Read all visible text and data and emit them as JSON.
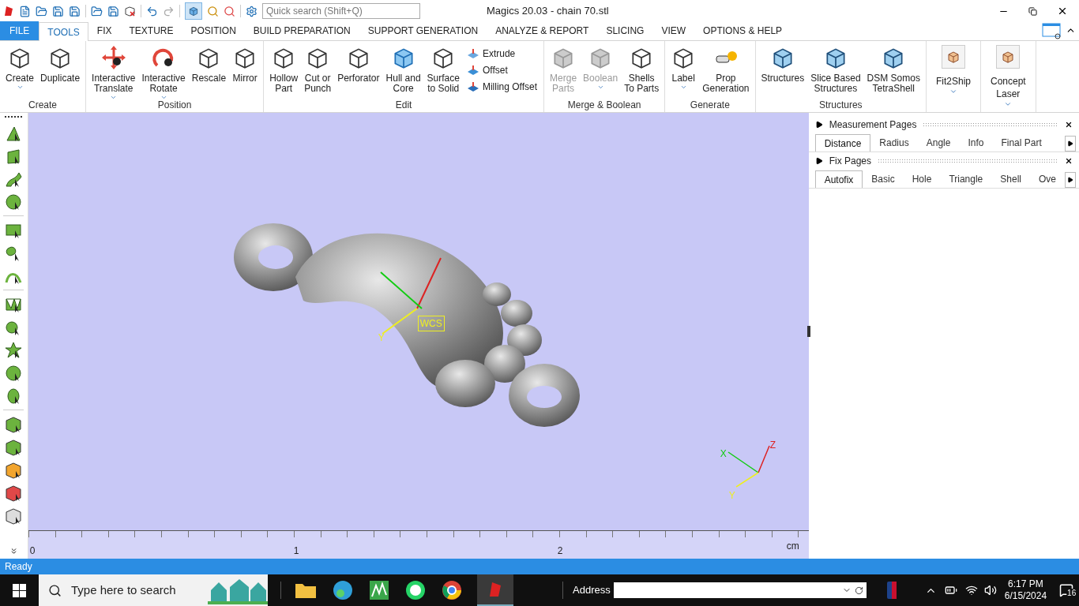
{
  "window": {
    "title": "Magics 20.03 - chain 70.stl"
  },
  "quick_search": {
    "placeholder": "Quick search (Shift+Q)"
  },
  "tabs": [
    {
      "label": "FILE",
      "kind": "file",
      "selected": false
    },
    {
      "label": "TOOLS",
      "kind": "tab",
      "selected": true
    },
    {
      "label": "FIX",
      "kind": "tab",
      "selected": false
    },
    {
      "label": "TEXTURE",
      "kind": "tab",
      "selected": false
    },
    {
      "label": "POSITION",
      "kind": "tab",
      "selected": false
    },
    {
      "label": "BUILD PREPARATION",
      "kind": "tab",
      "selected": false
    },
    {
      "label": "SUPPORT GENERATION",
      "kind": "tab",
      "selected": false
    },
    {
      "label": "ANALYZE & REPORT",
      "kind": "tab",
      "selected": false
    },
    {
      "label": "SLICING",
      "kind": "tab",
      "selected": false
    },
    {
      "label": "VIEW",
      "kind": "tab",
      "selected": false
    },
    {
      "label": "OPTIONS & HELP",
      "kind": "tab",
      "selected": false
    }
  ],
  "ribbon": [
    {
      "label": "Create",
      "buttons": [
        {
          "kind": "large",
          "label": "Create",
          "dropdown": true,
          "disabled": false
        },
        {
          "kind": "large",
          "label": "Duplicate",
          "dropdown": false,
          "disabled": false
        }
      ]
    },
    {
      "label": "Position",
      "buttons": [
        {
          "kind": "large",
          "label": "Interactive\nTranslate",
          "dropdown": true,
          "disabled": false
        },
        {
          "kind": "large",
          "label": "Interactive\nRotate",
          "dropdown": true,
          "disabled": false
        },
        {
          "kind": "large",
          "label": "Rescale",
          "dropdown": false,
          "disabled": false
        },
        {
          "kind": "large",
          "label": "Mirror",
          "dropdown": false,
          "disabled": false
        }
      ]
    },
    {
      "label": "Edit",
      "buttons": [
        {
          "kind": "large",
          "label": "Hollow\nPart",
          "dropdown": false,
          "disabled": false
        },
        {
          "kind": "large",
          "label": "Cut or\nPunch",
          "dropdown": false,
          "disabled": false
        },
        {
          "kind": "large",
          "label": "Perforator",
          "dropdown": false,
          "disabled": false
        },
        {
          "kind": "large",
          "label": "Hull and\nCore",
          "dropdown": false,
          "disabled": false
        },
        {
          "kind": "large",
          "label": "Surface\nto Solid",
          "dropdown": false,
          "disabled": false
        },
        {
          "kind": "small",
          "label": "Extrude",
          "disabled": false
        },
        {
          "kind": "small",
          "label": "Offset",
          "disabled": false
        },
        {
          "kind": "small",
          "label": "Milling Offset",
          "disabled": false
        }
      ]
    },
    {
      "label": "Merge & Boolean",
      "buttons": [
        {
          "kind": "large",
          "label": "Merge\nParts",
          "dropdown": false,
          "disabled": true
        },
        {
          "kind": "large",
          "label": "Boolean",
          "dropdown": true,
          "disabled": true
        },
        {
          "kind": "large",
          "label": "Shells\nTo Parts",
          "dropdown": false,
          "disabled": false
        }
      ]
    },
    {
      "label": "Generate",
      "buttons": [
        {
          "kind": "large",
          "label": "Label",
          "dropdown": true,
          "disabled": false
        },
        {
          "kind": "large",
          "label": "Prop\nGeneration",
          "dropdown": false,
          "disabled": false
        }
      ]
    },
    {
      "label": "Structures",
      "buttons": [
        {
          "kind": "large",
          "label": "Structures",
          "dropdown": false,
          "disabled": false
        },
        {
          "kind": "large",
          "label": "Slice Based\nStructures",
          "dropdown": false,
          "disabled": false
        },
        {
          "kind": "large",
          "label": "DSM Somos\nTetraShell",
          "dropdown": false,
          "disabled": false
        }
      ]
    },
    {
      "buttons": [
        {
          "kind": "plugin",
          "label": "Fit2Ship",
          "dropdown": true,
          "disabled": false
        }
      ]
    },
    {
      "buttons": [
        {
          "kind": "plugin",
          "label": "Concept\nLaser",
          "dropdown": true,
          "disabled": false
        }
      ]
    }
  ],
  "viewport": {
    "wcs_label": "WCS",
    "part_axis_label": "Y",
    "triad": [
      "X",
      "Y",
      "Z"
    ],
    "ruler": {
      "ticks": [
        "0",
        "1",
        "2"
      ],
      "unit": "cm"
    }
  },
  "panels": [
    {
      "title": "Measurement Pages",
      "tabs": [
        {
          "label": "Distance",
          "selected": true
        },
        {
          "label": "Radius",
          "selected": false
        },
        {
          "label": "Angle",
          "selected": false
        },
        {
          "label": "Info",
          "selected": false
        },
        {
          "label": "Final Part",
          "selected": false
        }
      ]
    },
    {
      "title": "Fix Pages",
      "tabs": [
        {
          "label": "Autofix",
          "selected": true
        },
        {
          "label": "Basic",
          "selected": false
        },
        {
          "label": "Hole",
          "selected": false
        },
        {
          "label": "Triangle",
          "selected": false
        },
        {
          "label": "Shell",
          "selected": false
        },
        {
          "label": "Ove",
          "selected": false
        }
      ]
    }
  ],
  "status_bar": {
    "text": "Ready"
  },
  "taskbar": {
    "search_placeholder": "Type here to search",
    "address_label": "Address",
    "time": "6:17 PM",
    "date": "6/15/2024",
    "notifications": "16"
  }
}
